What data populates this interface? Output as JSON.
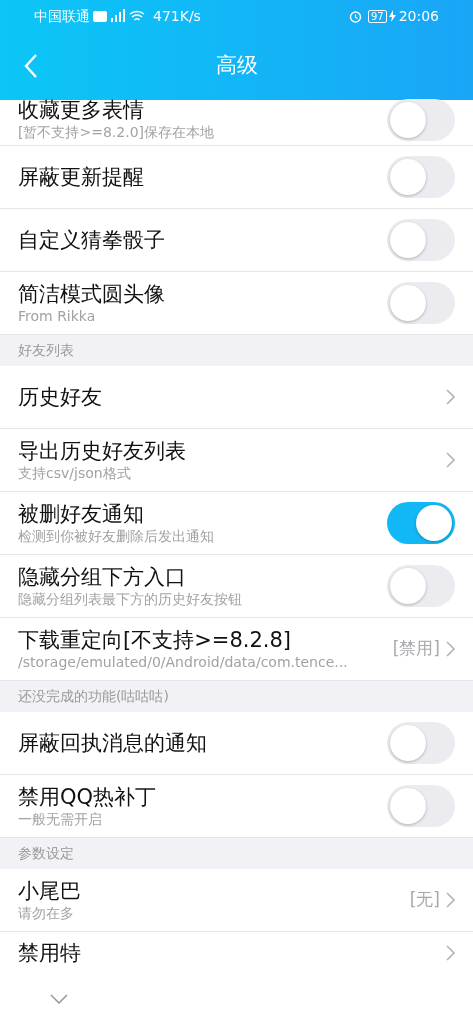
{
  "status_bar": {
    "carrier": "中国联通",
    "speed": "471K/s",
    "battery": "97",
    "time": "20:06"
  },
  "header": {
    "title": "高级"
  },
  "items": [
    {
      "kind": "toggle",
      "title": "收藏更多表情",
      "subtitle": "[暂不支持>=8.2.0]保存在本地",
      "on": false
    },
    {
      "kind": "toggle",
      "title": "屏蔽更新提醒",
      "on": false
    },
    {
      "kind": "toggle",
      "title": "自定义猜拳骰子",
      "on": false
    },
    {
      "kind": "toggle",
      "title": "简洁模式圆头像",
      "subtitle": "From Rikka",
      "on": false
    },
    {
      "kind": "section",
      "title": "好友列表"
    },
    {
      "kind": "link",
      "title": "历史好友"
    },
    {
      "kind": "link",
      "title": "导出历史好友列表",
      "subtitle": "支持csv/json格式"
    },
    {
      "kind": "toggle",
      "title": "被删好友通知",
      "subtitle": "检测到你被好友删除后发出通知",
      "on": true
    },
    {
      "kind": "toggle",
      "title": "隐藏分组下方入口",
      "subtitle": "隐藏分组列表最下方的历史好友按钮",
      "on": false
    },
    {
      "kind": "link",
      "title": "下载重定向[不支持>=8.2.8]",
      "subtitle": "/storage/emulated/0/Android/data/com.tence...",
      "value": "[禁用]"
    },
    {
      "kind": "section",
      "title": "还没完成的功能(咕咕咕)"
    },
    {
      "kind": "toggle",
      "title": "屏蔽回执消息的通知",
      "on": false
    },
    {
      "kind": "toggle",
      "title": "禁用QQ热补丁",
      "subtitle": "一般无需开启",
      "on": false
    },
    {
      "kind": "section",
      "title": "参数设定"
    },
    {
      "kind": "link",
      "title": "小尾巴",
      "subtitle": "请勿在多",
      "value": "[无]"
    },
    {
      "kind": "link",
      "title": "禁用特"
    }
  ]
}
